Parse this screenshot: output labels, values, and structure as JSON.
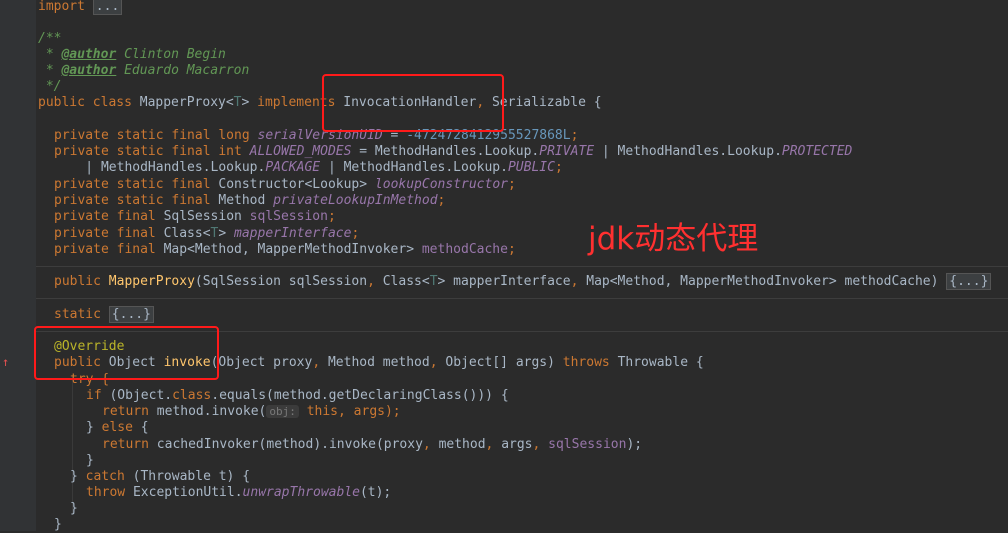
{
  "code": {
    "import_kw": "import",
    "import_fold": "...",
    "doc_open": "/**",
    "author_prefix": " * ",
    "author_tag": "@author",
    "author1": " Clinton Begin",
    "author2": " Eduardo Macarron",
    "doc_close": " */",
    "class_decl": {
      "kw1": "public class",
      "name": " MapperProxy",
      "lt": "<",
      "tparam": "T",
      "gt": "> ",
      "impl": "implements",
      "iface1": " InvocationHandler",
      "comma": ", ",
      "iface2": "Serializable {"
    },
    "f1": {
      "kw": "private static final long ",
      "name": "serialVersionUID",
      "eq": " = ",
      "val": "-4724728412955527868L",
      "end": ";"
    },
    "f2": {
      "kw": "private static final int ",
      "name": "ALLOWED_MODES",
      "eq": " = MethodHandles.Lookup.",
      "c1": "PRIVATE",
      "bar": " | MethodHandles.Lookup.",
      "c2": "PROTECTED"
    },
    "f2b": {
      "pre": "    | MethodHandles.Lookup.",
      "c3": "PACKAGE",
      "bar": " | MethodHandles.Lookup.",
      "c4": "PUBLIC",
      "end": ";"
    },
    "f3": {
      "kw": "private static final ",
      "type": "Constructor<Lookup> ",
      "name": "lookupConstructor",
      "end": ";"
    },
    "f4": {
      "kw": "private static final ",
      "type": "Method ",
      "name": "privateLookupInMethod",
      "end": ";"
    },
    "f5": {
      "kw": "private final ",
      "type": "SqlSession ",
      "name": "sqlSession",
      "end": ";"
    },
    "f6": {
      "kw": "private final ",
      "type": "Class<",
      "tp": "T",
      "type2": "> ",
      "name": "mapperInterface",
      "end": ";"
    },
    "f7": {
      "kw": "private final ",
      "type": "Map<Method, MapperMethodInvoker> ",
      "name": "methodCache",
      "end": ";"
    },
    "ctor": {
      "kw": "public ",
      "name": "MapperProxy",
      "params1": "(SqlSession sqlSession",
      "c1": ", ",
      "p2": "Class<",
      "tp": "T",
      "p2b": "> mapperInterface",
      "c2": ", ",
      "p3": "Map<Method, MapperMethodInvoker> methodCache) ",
      "fold": "{...}"
    },
    "static_kw": "static ",
    "static_fold": "{...}",
    "annotation": "@Override",
    "invoke_decl": {
      "kw": "public ",
      "type": "Object ",
      "name": "invoke",
      "params": "(Object proxy",
      "c1": ", ",
      "p2": "Method method",
      "c2": ", ",
      "p3": "Object[] args) ",
      "throws": "throws ",
      "exc": "Throwable {"
    },
    "try_kw": "try {",
    "if_line": {
      "kw": "if ",
      "open": "(Object.",
      "cls": "class",
      "rest": ".equals(method.getDeclaringClass())) {"
    },
    "ret1": {
      "kw": "return ",
      "call": "method.invoke(",
      "hint": "obj:",
      "args": " this, args);"
    },
    "else_line": {
      "brace": "} ",
      "kw": "else ",
      "open": "{"
    },
    "ret2": {
      "kw": "return ",
      "call": "cachedInvoker(method).invoke(proxy",
      "c1": ", ",
      "a2": "method",
      "c2": ", ",
      "a3": "args",
      "c3": ", ",
      "a4": "sqlSession",
      "end": ");"
    },
    "close1": "}",
    "catch_line": {
      "brace": "} ",
      "kw": "catch ",
      "rest": "(Throwable t) {"
    },
    "throw_line": {
      "kw": "throw ",
      "cls": "ExceptionUtil.",
      "fn": "unwrapThrowable",
      "rest": "(t);"
    },
    "close2": "}",
    "close3": "}"
  },
  "overlay_text": "jdk动态代理",
  "colors": {
    "background": "#2b2b2b",
    "annotation_box": "#ff1a1a",
    "overlay_text": "#ff3030"
  }
}
